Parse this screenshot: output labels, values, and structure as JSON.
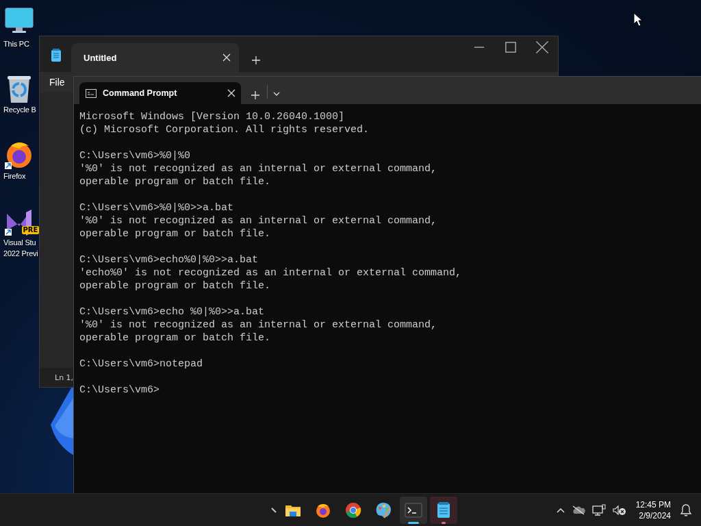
{
  "desktop_icons": [
    {
      "kind": "pc",
      "lines": [
        "This PC"
      ]
    },
    {
      "kind": "recycle",
      "lines": [
        "Recycle B"
      ]
    },
    {
      "kind": "firefox",
      "lines": [
        "Firefox"
      ]
    },
    {
      "kind": "vs",
      "lines": [
        "Visual Stu",
        "2022 Previ"
      ],
      "badge": "PRE"
    }
  ],
  "notepad": {
    "tabs": [
      {
        "label": "Untitled",
        "selected": true
      }
    ],
    "menu": [
      "File"
    ],
    "status": "Ln 1,"
  },
  "terminal": {
    "tabs": [
      {
        "label": "Command Prompt",
        "selected": true
      }
    ],
    "blocks": [
      [
        "Microsoft Windows [Version 10.0.26040.1000]",
        "(c) Microsoft Corporation. All rights reserved."
      ],
      [
        "C:\\Users\\vm6>%0|%0",
        "'%0' is not recognized as an internal or external command,",
        "operable program or batch file."
      ],
      [
        "C:\\Users\\vm6>%0|%0>>a.bat",
        "'%0' is not recognized as an internal or external command,",
        "operable program or batch file."
      ],
      [
        "C:\\Users\\vm6>echo%0|%0>>a.bat",
        "'echo%0' is not recognized as an internal or external command,",
        "operable program or batch file."
      ],
      [
        "C:\\Users\\vm6>echo %0|%0>>a.bat",
        "'%0' is not recognized as an internal or external command,",
        "operable program or batch file."
      ],
      [
        "C:\\Users\\vm6>notepad"
      ],
      [
        "C:\\Users\\vm6>"
      ]
    ]
  },
  "taskbar": {
    "apps": [
      {
        "kind": "folder",
        "selected": false,
        "running": false,
        "attention": false
      },
      {
        "kind": "firefox",
        "selected": false,
        "running": false,
        "attention": false
      },
      {
        "kind": "chrome",
        "selected": false,
        "running": false,
        "attention": false
      },
      {
        "kind": "paint",
        "selected": false,
        "running": false,
        "attention": false
      },
      {
        "kind": "terminal",
        "selected": true,
        "running": true,
        "attention": false
      },
      {
        "kind": "notepad",
        "selected": false,
        "running": true,
        "attention": true
      }
    ],
    "time": "12:45 PM",
    "date": "2/9/2024"
  }
}
